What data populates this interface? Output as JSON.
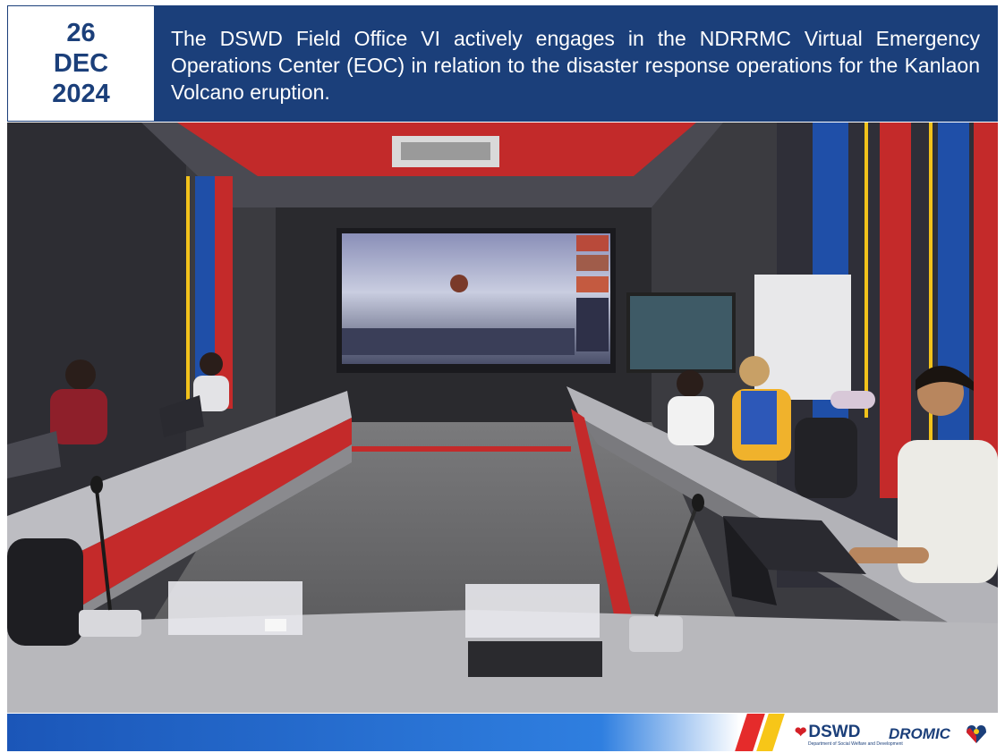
{
  "date": {
    "day": "26",
    "month": "DEC",
    "year": "2024"
  },
  "headline": "The DSWD Field Office VI actively engages in the NDRRMC Virtual Emergency Operations Center (EOC) in relation to the disaster response operations for the Kanlaon Volcano eruption.",
  "footer": {
    "logos": {
      "dswd": "DSWD",
      "dswd_sub": "Department of Social Welfare and Development",
      "dromic": "DROMIC"
    }
  },
  "colors": {
    "header_blue": "#1b3f7a",
    "stripe_red": "#e52b2b",
    "stripe_yellow": "#f7c618",
    "footer_blue": "#2f7fe0"
  }
}
